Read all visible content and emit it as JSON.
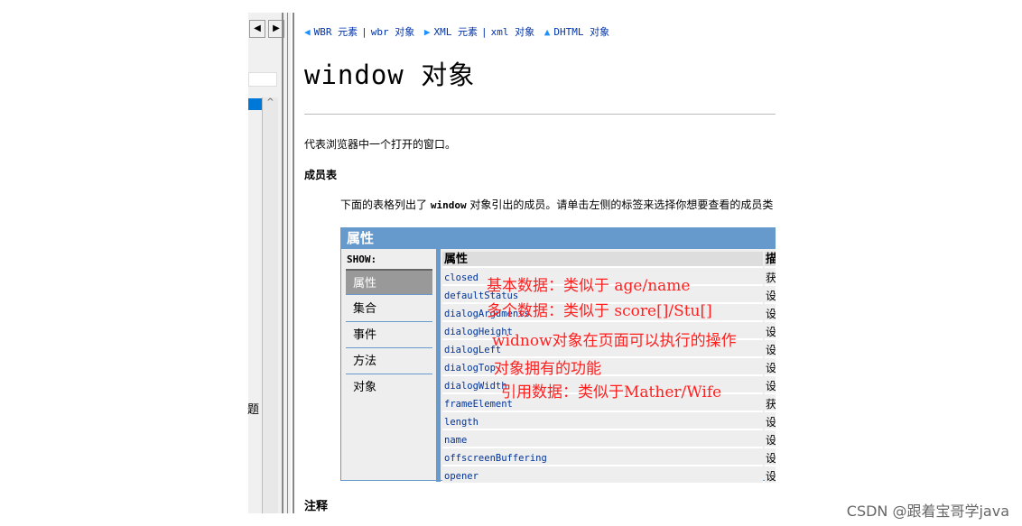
{
  "left_pane": {
    "prev": "◀",
    "next": "▶",
    "scroll_up": "^",
    "clipped_text": "题"
  },
  "nav": {
    "prev_links": [
      "WBR 元素",
      "wbr 对象"
    ],
    "next_links": [
      "XML 元素",
      "xml 对象"
    ],
    "up_link": "DHTML 对象",
    "separator": "|"
  },
  "title": "window 对象",
  "description": "代表浏览器中一个打开的窗口。",
  "members_heading": "成员表",
  "members_intro_pre": "下面的表格列出了 ",
  "members_intro_code": "window",
  "members_intro_post": " 对象引出的成员。请单击左侧的标签来选择你想要查看的成员类",
  "table": {
    "title": "属性",
    "show_label": "SHOW:",
    "tabs": [
      {
        "label": "属性",
        "selected": true
      },
      {
        "label": "集合"
      },
      {
        "label": "事件"
      },
      {
        "label": "方法"
      },
      {
        "label": "对象"
      }
    ],
    "col_headers": [
      "属性",
      "描"
    ],
    "rows": [
      {
        "name": "closed",
        "desc": "获"
      },
      {
        "name": "defaultStatus",
        "desc": "设"
      },
      {
        "name": "dialogArguments",
        "desc": "设"
      },
      {
        "name": "dialogHeight",
        "desc": "设"
      },
      {
        "name": "dialogLeft",
        "desc": "设"
      },
      {
        "name": "dialogTop",
        "desc": "设"
      },
      {
        "name": "dialogWidth",
        "desc": "设"
      },
      {
        "name": "frameElement",
        "desc": "获"
      },
      {
        "name": "length",
        "desc": "设"
      },
      {
        "name": "name",
        "desc": "设"
      },
      {
        "name": "offscreenBuffering",
        "desc": "设"
      },
      {
        "name": "opener",
        "desc": "设"
      }
    ]
  },
  "annotations": [
    "基本数据：类似于 age/name",
    "多个数据：类似于 score[]/Stu[]",
    "widnow对象在页面可以执行的操作",
    "对象拥有的功能",
    "引用数据：类似于Mather/Wife"
  ],
  "notes_heading": "注释",
  "watermark": "CSDN @跟着宝哥学java"
}
